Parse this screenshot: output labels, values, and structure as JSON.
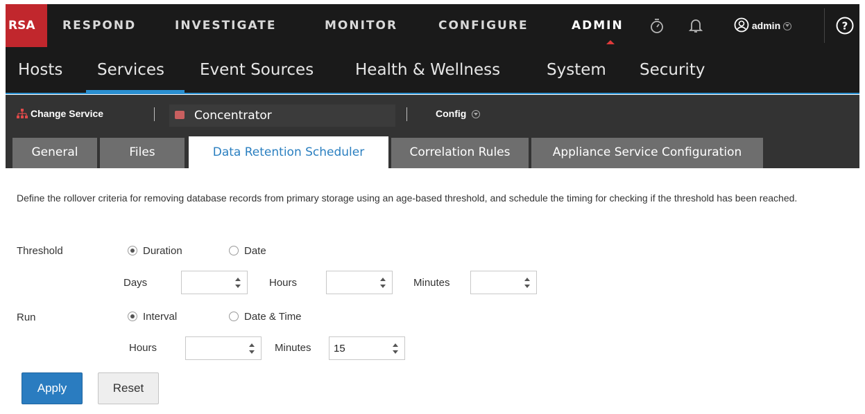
{
  "top_nav": {
    "logo": "RSA",
    "items": [
      "RESPOND",
      "INVESTIGATE",
      "MONITOR",
      "CONFIGURE",
      "ADMIN"
    ],
    "active": "ADMIN",
    "user": "admin",
    "icons": [
      "stopwatch-icon",
      "bell-icon",
      "user-icon",
      "help-icon"
    ]
  },
  "sub_nav": {
    "items": [
      "Hosts",
      "Services",
      "Event Sources",
      "Health & Wellness",
      "System",
      "Security"
    ],
    "active": "Services"
  },
  "service_bar": {
    "change_service": "Change Service",
    "service_name": "Concentrator",
    "config": "Config"
  },
  "tabs": {
    "items": [
      "General",
      "Files",
      "Data Retention Scheduler",
      "Correlation Rules",
      "Appliance Service Configuration"
    ],
    "active": "Data Retention Scheduler"
  },
  "form": {
    "description": "Define the rollover criteria for removing database records from primary storage using an age-based threshold, and schedule the timing for checking if the threshold has been reached.",
    "threshold": {
      "label": "Threshold",
      "options": [
        "Duration",
        "Date"
      ],
      "selected": "Duration",
      "days_label": "Days",
      "days_value": "",
      "hours_label": "Hours",
      "hours_value": "",
      "minutes_label": "Minutes",
      "minutes_value": ""
    },
    "run": {
      "label": "Run",
      "options": [
        "Interval",
        "Date & Time"
      ],
      "selected": "Interval",
      "hours_label": "Hours",
      "hours_value": "",
      "minutes_label": "Minutes",
      "minutes_value": "15"
    },
    "apply_label": "Apply",
    "reset_label": "Reset"
  },
  "colors": {
    "logo_red": "#c1272d",
    "nav_bg": "#1a1a1a",
    "accent_blue": "#2a8fd0",
    "tab_inactive": "#6e6e6e",
    "apply_blue": "#2a7cc0"
  }
}
